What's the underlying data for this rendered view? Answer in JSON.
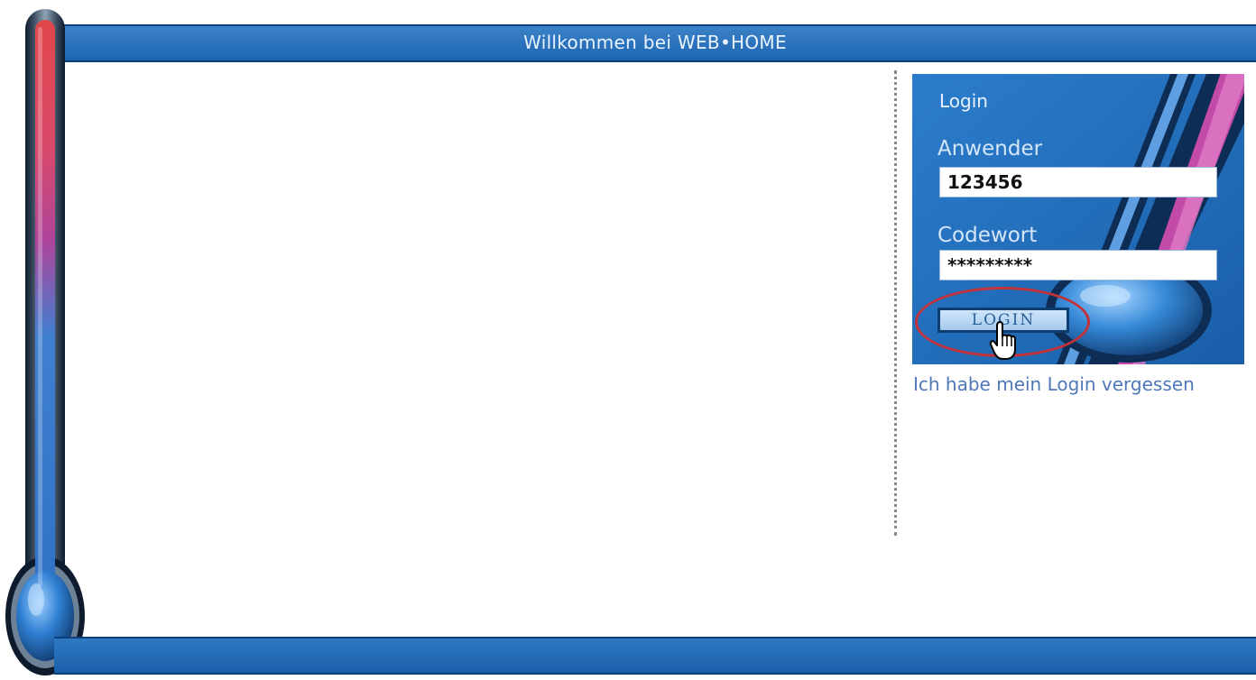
{
  "header": {
    "title": "Willkommen bei WEB•HOME"
  },
  "login": {
    "title": "Login",
    "username_label": "Anwender",
    "username_value": "123456",
    "password_label": "Codewort",
    "password_value": "*********",
    "button_label": "LOGIN",
    "forgot_link": "Ich habe mein Login vergessen"
  },
  "colors": {
    "brand_blue": "#1e6db8",
    "header_text": "#eaf3ff",
    "highlight_ring": "#c2323b",
    "link": "#4f78b8"
  },
  "icons": {
    "thermometer": "thermometer-icon",
    "cursor": "hand-pointer-icon"
  }
}
